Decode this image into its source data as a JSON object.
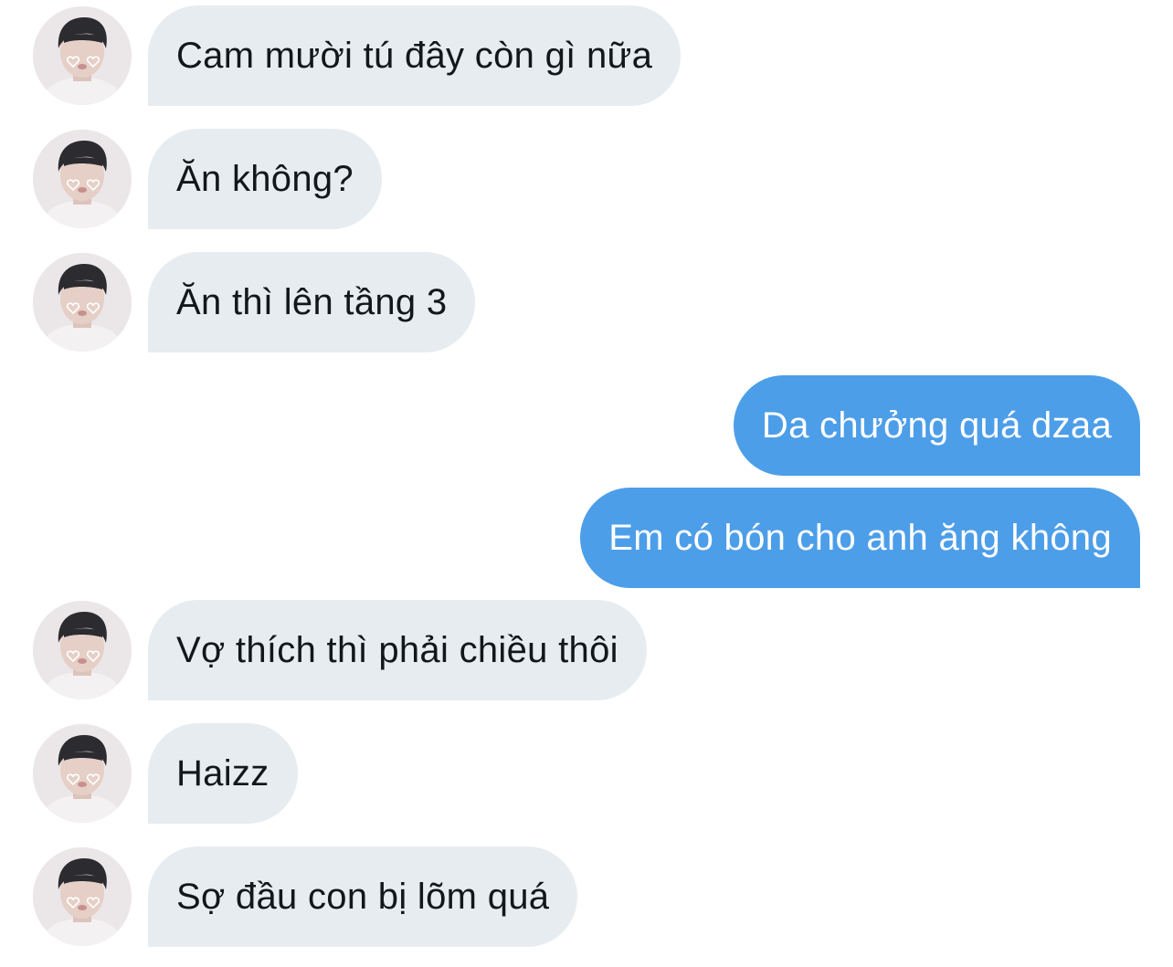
{
  "conversation": {
    "messages": [
      {
        "direction": "incoming",
        "text": "Cam mười tú đây còn gì nữa",
        "has_avatar": true
      },
      {
        "direction": "incoming",
        "text": "Ăn không?",
        "has_avatar": true
      },
      {
        "direction": "incoming",
        "text": "Ăn thì lên tầng 3",
        "has_avatar": true
      },
      {
        "direction": "outgoing",
        "text": "Da chưởng quá dzaa",
        "has_avatar": false
      },
      {
        "direction": "outgoing",
        "text": "Em có bón cho anh ăng không",
        "has_avatar": false
      },
      {
        "direction": "incoming",
        "text": "Vợ thích thì phải chiều thôi",
        "has_avatar": true
      },
      {
        "direction": "incoming",
        "text": "Haizz",
        "has_avatar": true
      },
      {
        "direction": "incoming",
        "text": "Sợ đầu con bị lõm quá",
        "has_avatar": true
      }
    ]
  },
  "colors": {
    "incoming_bubble": "#e6ecf0",
    "incoming_text": "#14171a",
    "outgoing_bubble": "#4d9ee8",
    "outgoing_text": "#ffffff",
    "background": "#ffffff"
  },
  "icons": {
    "avatar": "user-photo-avatar"
  }
}
